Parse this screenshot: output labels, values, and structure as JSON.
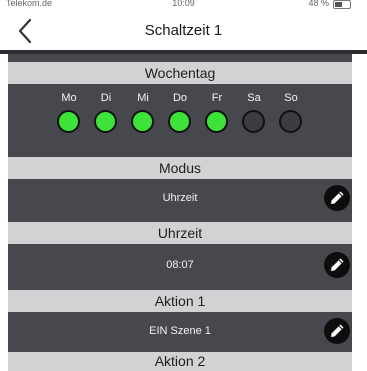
{
  "status_bar": {
    "carrier": "Telekom.de",
    "time": "10:09",
    "battery": "48 %"
  },
  "nav": {
    "title": "Schaltzeit 1"
  },
  "weekday": {
    "header": "Wochentag",
    "days": [
      {
        "label": "Mo",
        "active": true
      },
      {
        "label": "Di",
        "active": true
      },
      {
        "label": "Mi",
        "active": true
      },
      {
        "label": "Do",
        "active": true
      },
      {
        "label": "Fr",
        "active": true
      },
      {
        "label": "Sa",
        "active": false
      },
      {
        "label": "So",
        "active": false
      }
    ]
  },
  "modus": {
    "header": "Modus",
    "value": "Uhrzeit"
  },
  "uhrzeit": {
    "header": "Uhrzeit",
    "value": "08:07"
  },
  "aktion1": {
    "header": "Aktion 1",
    "value": "EIN Szene 1"
  },
  "aktion2": {
    "header": "Aktion 2"
  },
  "colors": {
    "active_dot": "#3ee33a",
    "row_background": "#46484d",
    "header_background": "#d2d2d4"
  }
}
